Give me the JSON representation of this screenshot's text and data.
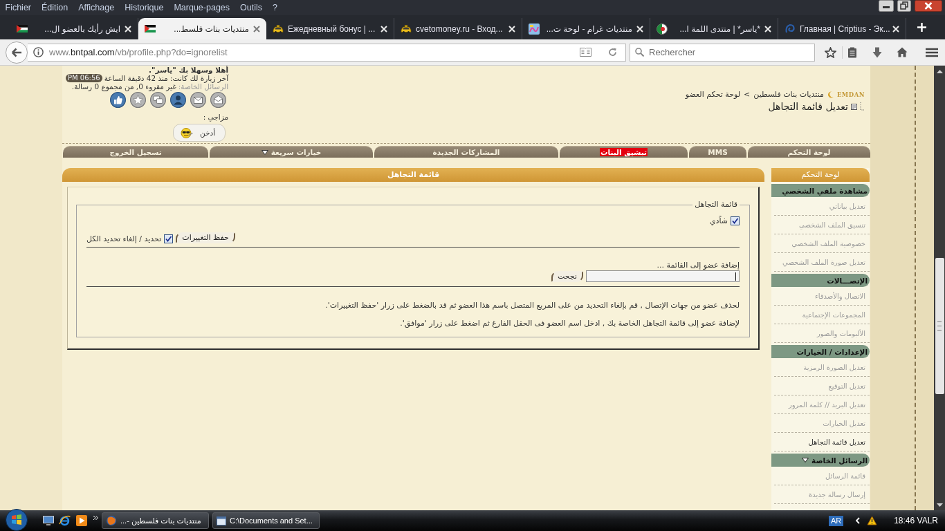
{
  "menu_bar": [
    "?",
    "Outils",
    "Marque-pages",
    "Historique",
    "Affichage",
    "Édition",
    "Fichier"
  ],
  "tabs": [
    {
      "title": "Главная | Criptius - Эк...",
      "selected": false
    },
    {
      "title": "*ياسر* | منتدى اللمة ا...",
      "selected": false
    },
    {
      "title": "منتديات غرام - لوحة ت...",
      "selected": false
    },
    {
      "title": "cvetomoney.ru - Вход...",
      "selected": false
    },
    {
      "title": "Ежедневный бонус | ...",
      "selected": false
    },
    {
      "title": "منتديات بنات فلسط...",
      "selected": true
    },
    {
      "title": "ايش رأيك بالعضو ال...",
      "selected": false
    }
  ],
  "address_bar": {
    "url": {
      "prefix": "www.",
      "domain": "bntpal.com",
      "path": "/vb/profile.php?do=ignorelist"
    },
    "search_placeholder": "Rechercher"
  },
  "user_box": {
    "greeting": "أهلا وسهلا بك \"ياسر\".",
    "last_visit": "آخر زيارة لك كانت: منذ 42 دقيقة الساعة",
    "last_visit_time": "PM 06:56",
    "messages_label": "الرسائل الخاصة:",
    "messages_value": "غير مقروء 0, من مجموع 0 رسالة.",
    "mood_label": "مزاجي :",
    "mood": "أدخن"
  },
  "breadcrumb": {
    "logo": "EMDAN",
    "links": [
      "منتديات بنات فلسطين",
      "لوحة تحكم العضو"
    ],
    "separator": ">"
  },
  "page_title": "تعديل قائمة التجاهل",
  "nav_tabs": [
    {
      "label": "لوحة التحكم",
      "highlighted": false,
      "dropdown": false
    },
    {
      "label": "MMS",
      "highlighted": false,
      "dropdown": false
    },
    {
      "label": "تبشيق البنات",
      "highlighted": true,
      "dropdown": false
    },
    {
      "label": "المشاركات الجديدة",
      "highlighted": false,
      "dropdown": false
    },
    {
      "label": "خيارات سريعة",
      "highlighted": false,
      "dropdown": true
    },
    {
      "label": "تسجيل الخروج",
      "highlighted": false,
      "dropdown": false
    }
  ],
  "panel": {
    "title": "قائمة التجاهل",
    "legend": "قائمة التجاهل",
    "members": [
      {
        "name": "شاًدي",
        "checked": true
      }
    ],
    "save_button": "حفظ التغييرات",
    "select_all": {
      "label": "تحديد / إلغاء تحديد الكل",
      "checked": true
    },
    "add_label": "إضافة عضو إلى القائمة ...",
    "add_button": "نجحت",
    "help": [
      "لحذف عضو من جهات الإتصال , قم بإلغاء التحديد من على المربع المتصل باسم هذا العضو ثم قد بالضغط على زرار 'حفظ التغييرات'.",
      "لإضافة عضو إلى قائمة التجاهل الخاصة بك , ادخل اسم العضو فى الحقل الفارغ ثم اضغط على زرار 'موافق'."
    ]
  },
  "sidebar": {
    "title": "لوحة التحكم",
    "sections": [
      {
        "title": "مشاهدة ملفي الشخصي",
        "dropdown": false,
        "items": [
          {
            "label": "تعديل بياناتي",
            "selected": false
          },
          {
            "label": "تنسيق الملف الشخصي",
            "selected": false
          },
          {
            "label": "خصوصية الملف الشخصي",
            "selected": false
          },
          {
            "label": "تعديل صورة الملف الشخصي",
            "selected": false
          }
        ]
      },
      {
        "title": "الإتصـــالات",
        "dropdown": false,
        "items": [
          {
            "label": "الاتصال والأصدقاء",
            "selected": false
          },
          {
            "label": "المجموعات الإجتماعية",
            "selected": false
          },
          {
            "label": "الألبومات والصور",
            "selected": false
          }
        ]
      },
      {
        "title": "الإعدادات / الخيارات",
        "dropdown": false,
        "items": [
          {
            "label": "تعديل الصورة الرمزية",
            "selected": false
          },
          {
            "label": "تعديل التوقيع",
            "selected": false
          },
          {
            "label": "تعديل البريد // كلمة المرور",
            "selected": false
          },
          {
            "label": "تعديل الخيارات",
            "selected": false
          },
          {
            "label": "تعديل قائمة التجاهل",
            "selected": true
          }
        ]
      },
      {
        "title": "الرسائل الخاصة",
        "dropdown": true,
        "items": [
          {
            "label": "قائمة الرسائل",
            "selected": false
          },
          {
            "label": "إرسال رسالة جديدة",
            "selected": false
          }
        ]
      }
    ]
  },
  "taskbar": {
    "tasks": [
      "C:\\Documents and Set...",
      "منتديات بنات فلسطين -..."
    ],
    "language": "AR",
    "clock": "18:46 VALR"
  }
}
